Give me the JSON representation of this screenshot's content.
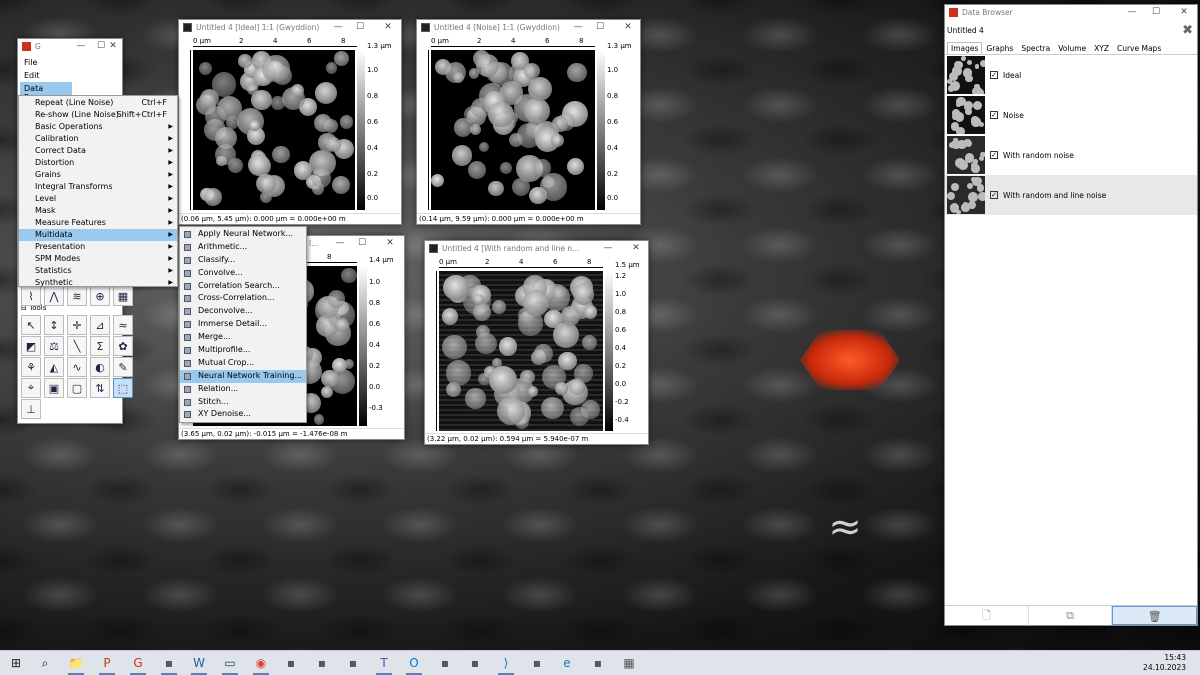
{
  "gwyddion_main": {
    "title": "G",
    "menu": [
      "File",
      "Edit",
      "Data Process"
    ],
    "tools_label": "Tools"
  },
  "data_process_menu": [
    {
      "label": "Repeat (Line Noise)",
      "shortcut": "Ctrl+F",
      "arrow": ""
    },
    {
      "label": "Re-show (Line Noise)",
      "shortcut": "Shift+Ctrl+F",
      "arrow": ""
    },
    {
      "label": "Basic Operations",
      "shortcut": "",
      "arrow": "▶"
    },
    {
      "label": "Calibration",
      "shortcut": "",
      "arrow": "▶"
    },
    {
      "label": "Correct Data",
      "shortcut": "",
      "arrow": "▶"
    },
    {
      "label": "Distortion",
      "shortcut": "",
      "arrow": "▶"
    },
    {
      "label": "Grains",
      "shortcut": "",
      "arrow": "▶"
    },
    {
      "label": "Integral Transforms",
      "shortcut": "",
      "arrow": "▶"
    },
    {
      "label": "Level",
      "shortcut": "",
      "arrow": "▶"
    },
    {
      "label": "Mask",
      "shortcut": "",
      "arrow": "▶"
    },
    {
      "label": "Measure Features",
      "shortcut": "",
      "arrow": "▶"
    },
    {
      "label": "Multidata",
      "shortcut": "",
      "arrow": "▶"
    },
    {
      "label": "Presentation",
      "shortcut": "",
      "arrow": "▶"
    },
    {
      "label": "SPM Modes",
      "shortcut": "",
      "arrow": "▶"
    },
    {
      "label": "Statistics",
      "shortcut": "",
      "arrow": "▶"
    },
    {
      "label": "Synthetic",
      "shortcut": "",
      "arrow": "▶"
    }
  ],
  "multidata_menu": [
    "Apply Neural Network...",
    "Arithmetic...",
    "Classify...",
    "Convolve...",
    "Correlation Search...",
    "Cross-Correlation...",
    "Deconvolve...",
    "Immerse Detail...",
    "Merge...",
    "Multiprofile...",
    "Mutual Crop...",
    "Neural Network Training...",
    "Relation...",
    "Stitch...",
    "XY Denoise..."
  ],
  "windows": {
    "ideal": {
      "title": "Untitled 4 [Ideal] 1:1 (Gwyddion)",
      "scale_top": "1.3 µm",
      "scale_ticks": [
        "1.0",
        "0.8",
        "0.6",
        "0.4",
        "0.2",
        "0.0"
      ],
      "ruler_unit": "0 µm",
      "ruler_ticks": [
        "2",
        "4",
        "6",
        "8"
      ],
      "vruler_unit": "0 µm",
      "status": "(0.06 µm, 5.45 µm): 0.000 µm = 0.000e+00 m"
    },
    "noise": {
      "title": "Untitled 4 [Noise] 1:1 (Gwyddion)",
      "scale_top": "1.3 µm",
      "scale_ticks": [
        "1.0",
        "0.8",
        "0.6",
        "0.4",
        "0.2",
        "0.0"
      ],
      "ruler_unit": "0 µm",
      "ruler_ticks": [
        "2",
        "4",
        "6",
        "8"
      ],
      "vruler_unit": "0 µm",
      "status": "(0.14 µm, 9.59 µm): 0.000 µm = 0.000e+00 m"
    },
    "random": {
      "title": "l...",
      "scale_top": "1.4 µm",
      "scale_ticks": [
        "1.0",
        "0.8",
        "0.6",
        "0.4",
        "0.2",
        "0.0",
        "-0.3"
      ],
      "ruler_ticks": [
        "8"
      ],
      "status": "(3.65 µm, 0.02 µm): -0.015 µm = -1.476e-08 m"
    },
    "random_line": {
      "title": "Untitled 4 [With random and line n...",
      "scale_top": "1.5 µm",
      "scale_ticks": [
        "1.2",
        "1.0",
        "0.8",
        "0.6",
        "0.4",
        "0.2",
        "0.0",
        "-0.2",
        "-0.4"
      ],
      "ruler_unit": "0 µm",
      "ruler_ticks": [
        "2",
        "4",
        "6",
        "8"
      ],
      "vruler_unit": "0 µm",
      "status": "(3.22 µm, 0.02 µm): 0.594 µm = 5.940e-07 m"
    }
  },
  "data_browser": {
    "title": "Data Browser",
    "file": "Untitled 4",
    "tabs": [
      "Images",
      "Graphs",
      "Spectra",
      "Volume",
      "XYZ",
      "Curve Maps"
    ],
    "items": [
      {
        "label": "Ideal",
        "checked": "✓"
      },
      {
        "label": "Noise",
        "checked": "✓"
      },
      {
        "label": "With random noise",
        "checked": "✓"
      },
      {
        "label": "With random and line noise",
        "checked": "✓"
      }
    ]
  },
  "taskbar": {
    "time": "15:43",
    "date": "24.10.2023",
    "icons": [
      "windows-start-icon",
      "search-icon",
      "file-explorer-icon",
      "powerpoint-icon",
      "gwyddion-icon",
      "app-icon",
      "word-icon",
      "terminal-icon",
      "chrome-icon",
      "app-icon",
      "app-icon",
      "app-icon",
      "teams-icon",
      "outlook-icon",
      "app-icon",
      "app-icon",
      "vscode-icon",
      "app-icon",
      "edge-icon",
      "app-icon",
      "calculator-icon"
    ]
  },
  "colors": {
    "menu_highlight": "#99c9ef",
    "gwyddion_red": "#d12e1c",
    "taskbar_bg": "#dfe3ea"
  }
}
